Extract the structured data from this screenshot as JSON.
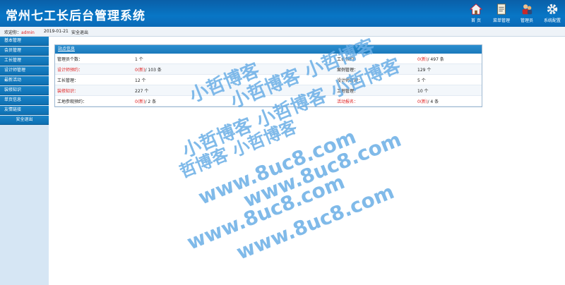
{
  "header": {
    "title": "常州七工长后台管理系统",
    "nav": [
      {
        "label": "首 页",
        "icon": "home-icon"
      },
      {
        "label": "菜单管理",
        "icon": "clipboard-icon"
      },
      {
        "label": "管理员",
        "icon": "admin-users-icon"
      },
      {
        "label": "系统配置",
        "icon": "gear-icon"
      }
    ]
  },
  "status_bar": {
    "welcome": "欢迎你：",
    "user": "admin",
    "date": "2019-01-21",
    "logout": "安全退出"
  },
  "sidebar": {
    "items": [
      "基本管理",
      "会员管理",
      "工长管理",
      "设计师管理",
      "最新活动",
      "装修知识",
      "单页信息",
      "友情链接",
      "安全退出"
    ]
  },
  "panel": {
    "title": "站点信息",
    "rows": [
      [
        {
          "label": "管理员个数：",
          "value": "1 个",
          "new": ""
        },
        {
          "label": "工长预约：",
          "value": "/ 497 条",
          "new": "0(新)"
        }
      ],
      [
        {
          "label": "设计师预约：",
          "value": "/ 103 条",
          "new": "0(新)",
          "red": true
        },
        {
          "label": "案例管理：",
          "value": "129 个",
          "new": ""
        }
      ],
      [
        {
          "label": "工长管理：",
          "value": "12 个",
          "new": ""
        },
        {
          "label": "设计师管理：",
          "value": "5 个",
          "new": ""
        }
      ],
      [
        {
          "label": "装修知识：",
          "value": "227 个",
          "new": "",
          "red": true
        },
        {
          "label": "工地管理：",
          "value": "10 个",
          "new": ""
        }
      ],
      [
        {
          "label": "工地参观预约：",
          "value": "/ 2 条",
          "new": "0(新)"
        },
        {
          "label": "活动报名：",
          "value": "/ 4 条",
          "new": "0(新)",
          "red": true
        }
      ]
    ]
  },
  "watermark": {
    "lines": [
      "小哲博客",
      "小哲博客 小哲博客",
      "小哲博客 小哲博客 小哲博客",
      "哲博客 小哲博客",
      "www.8uc8.com",
      "www.8uc8.com",
      "www.8uc8.com",
      "www.8uc8.com"
    ]
  }
}
